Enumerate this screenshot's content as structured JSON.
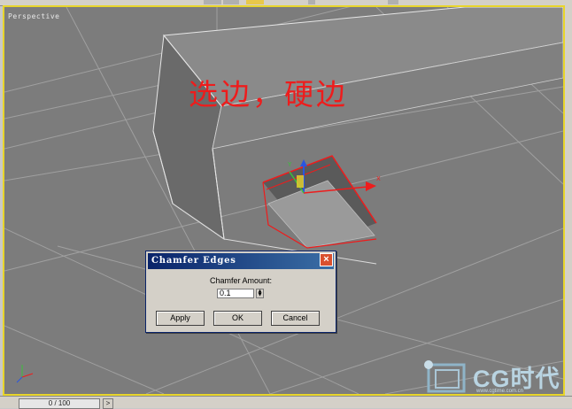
{
  "viewport": {
    "label": "Perspective",
    "annotation": "选边，硬边"
  },
  "timeline": {
    "frame": "0 / 100",
    "next": ">"
  },
  "dialog": {
    "title": "Chamfer Edges",
    "close": "×",
    "field_label": "Chamfer Amount:",
    "amount": "0.1",
    "buttons": {
      "apply": "Apply",
      "ok": "OK",
      "cancel": "Cancel"
    }
  },
  "watermark": {
    "brand": "CG时代",
    "url": "www.cgtime.com.cn"
  },
  "colors": {
    "viewport_bg": "#7c7c7c",
    "active_border": "#e8d52a",
    "selection": "#ee1c1c",
    "dialog_title": "#0a246a"
  },
  "icons": [
    "axis-tripod-icon",
    "transform-gizmo-icon",
    "close-icon",
    "spinner-icon",
    "cg-logo-icon"
  ]
}
